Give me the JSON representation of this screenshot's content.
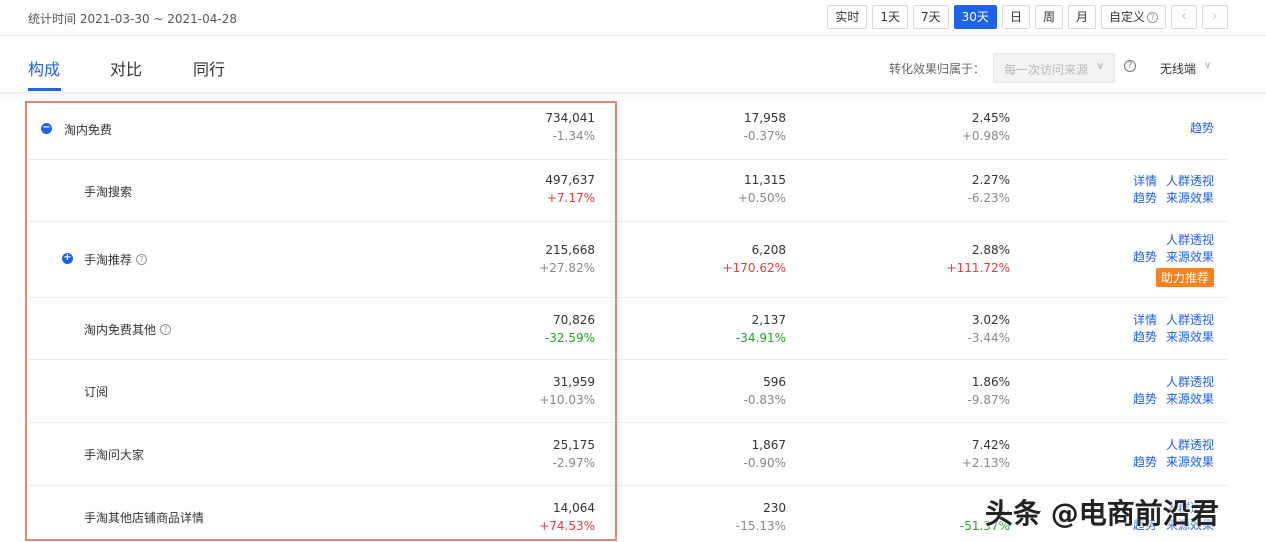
{
  "header": {
    "stat_time_label": "统计时间",
    "stat_time_range": "2021-03-30 ~ 2021-04-28",
    "range_buttons": [
      "实时",
      "1天",
      "7天",
      "30天",
      "日",
      "周",
      "月"
    ],
    "active_range": "30天",
    "custom_label": "自定义",
    "prev_icon": "chevron-left-icon",
    "next_icon": "chevron-right-icon"
  },
  "tabs": {
    "items": [
      "构成",
      "对比",
      "同行"
    ],
    "active": "构成"
  },
  "filters": {
    "attribution_label": "转化效果归属于：",
    "attribution_value": "每一次访问来源",
    "device_value": "无线端"
  },
  "rows": [
    {
      "name": "淘内免费",
      "expand": "minus",
      "v1": "734,041",
      "c1": "-1.34%",
      "v2": "17,958",
      "c2": "-0.37%",
      "v3": "2.45%",
      "c3": "+0.98%",
      "actions": [
        [
          "趋势"
        ]
      ]
    },
    {
      "name": "手淘搜索",
      "v1": "497,637",
      "c1": "+7.17%",
      "v2": "11,315",
      "c2": "+0.50%",
      "v3": "2.27%",
      "c3": "-6.23%",
      "actions": [
        [
          "详情",
          "人群透视"
        ],
        [
          "趋势",
          "来源效果"
        ]
      ]
    },
    {
      "name": "手淘推荐",
      "expand": "plus",
      "help": true,
      "v1": "215,668",
      "c1": "+27.82%",
      "v2": "6,208",
      "c2": "+170.62%",
      "v3": "2.88%",
      "c3": "+111.72%",
      "actions": [
        [
          "人群透视"
        ],
        [
          "趋势",
          "来源效果"
        ]
      ],
      "boost": "助力推荐"
    },
    {
      "name": "淘内免费其他",
      "help": true,
      "v1": "70,826",
      "c1": "-32.59%",
      "v2": "2,137",
      "c2": "-34.91%",
      "v3": "3.02%",
      "c3": "-3.44%",
      "actions": [
        [
          "详情",
          "人群透视"
        ],
        [
          "趋势",
          "来源效果"
        ]
      ]
    },
    {
      "name": "订阅",
      "v1": "31,959",
      "c1": "+10.03%",
      "v2": "596",
      "c2": "-0.83%",
      "v3": "1.86%",
      "c3": "-9.87%",
      "actions": [
        [
          "人群透视"
        ],
        [
          "趋势",
          "来源效果"
        ]
      ]
    },
    {
      "name": "手淘问大家",
      "v1": "25,175",
      "c1": "-2.97%",
      "v2": "1,867",
      "c2": "-0.90%",
      "v3": "7.42%",
      "c3": "+2.13%",
      "actions": [
        [
          "人群透视"
        ],
        [
          "趋势",
          "来源效果"
        ]
      ]
    },
    {
      "name": "手淘其他店铺商品详情",
      "v1": "14,064",
      "c1": "+74.53%",
      "v2": "230",
      "c2": "-15.13%",
      "v3": "1.",
      "c3": "-51.37%",
      "actions": [
        [
          "人群透视"
        ],
        [
          "趋势",
          "来源效果"
        ]
      ]
    }
  ],
  "colors": {
    "primary": "#2062e6",
    "increase": "#e33c3c",
    "decrease": "#2ba12b",
    "boost": "#f5811f",
    "highlight_border": "#d98a78"
  },
  "watermark": "头条 @电商前沿君"
}
